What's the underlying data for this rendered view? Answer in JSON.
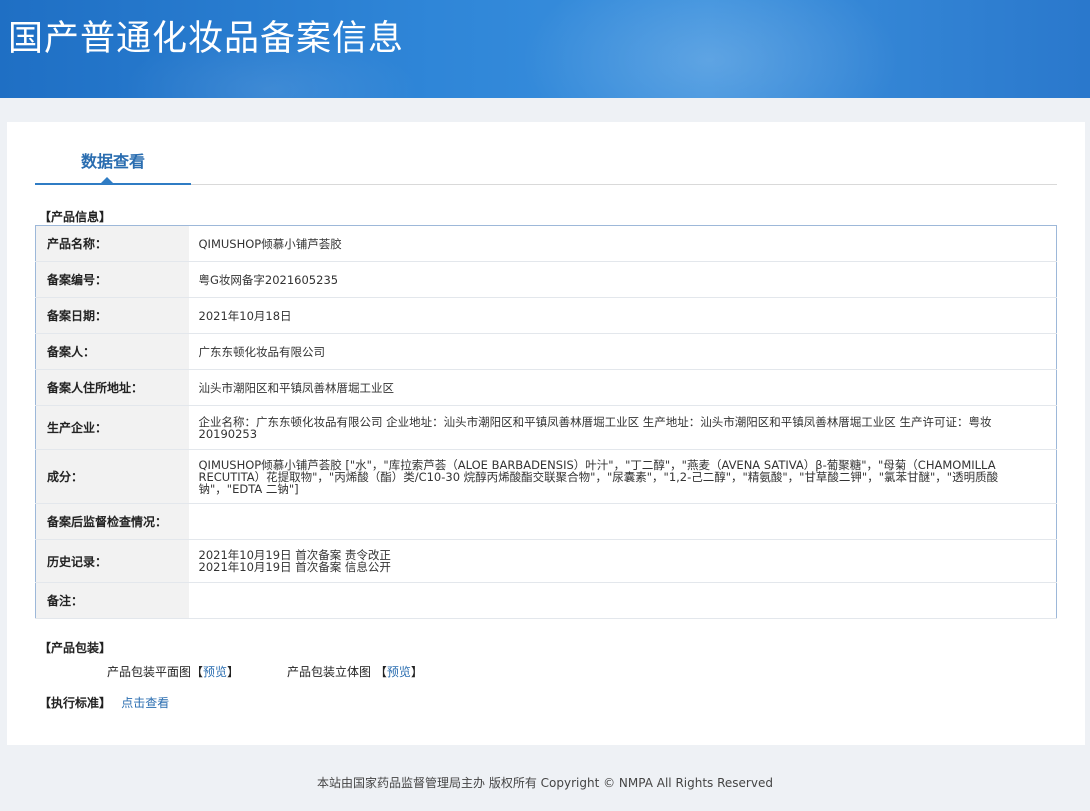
{
  "header": {
    "title": "国产普通化妆品备案信息"
  },
  "tabs": [
    {
      "label": "数据查看"
    }
  ],
  "sections": {
    "product_info": "【产品信息】",
    "product_packaging": "【产品包装】",
    "standard": "【执行标准】"
  },
  "product_table": [
    {
      "key": "产品名称：",
      "value": "QIMUSHOP倾慕小铺芦荟胶"
    },
    {
      "key": "备案编号：",
      "value": "粤G妆网备字2021605235"
    },
    {
      "key": "备案日期：",
      "value": "2021年10月18日"
    },
    {
      "key": "备案人：",
      "value": "广东东顿化妆品有限公司"
    },
    {
      "key": "备案人住所地址：",
      "value": "汕头市潮阳区和平镇凤善林厝堀工业区"
    },
    {
      "key": "生产企业：",
      "value": "企业名称：广东东顿化妆品有限公司 企业地址：汕头市潮阳区和平镇凤善林厝堀工业区 生产地址：汕头市潮阳区和平镇凤善林厝堀工业区 生产许可证：粤妆20190253"
    },
    {
      "key": "成分：",
      "value": "QIMUSHOP倾慕小铺芦荟胶 [\"水\"，\"库拉索芦荟（ALOE BARBADENSIS）叶汁\"，\"丁二醇\"，\"燕麦（AVENA SATIVA）β-葡聚糖\"，\"母菊（CHAMOMILLA RECUTITA）花提取物\"，\"丙烯酸（酯）类/C10-30 烷醇丙烯酸酯交联聚合物\"，\"尿囊素\"，\"1,2-己二醇\"，\"精氨酸\"，\"甘草酸二钾\"，\"氯苯甘醚\"，\"透明质酸钠\"，\"EDTA 二钠\"]"
    },
    {
      "key": "备案后监督检查情况：",
      "value": ""
    },
    {
      "key": "历史记录：",
      "value": "2021年10月19日 首次备案 责令改正\n2021年10月19日 首次备案 信息公开"
    },
    {
      "key": "备注：",
      "value": ""
    }
  ],
  "packaging": {
    "flat_label": "产品包装平面图",
    "flat_preview": "预览",
    "solid_label": "产品包装立体图",
    "solid_preview": "预览"
  },
  "standard": {
    "link": "点击查看"
  },
  "footer": {
    "text": "本站由国家药品监督管理局主办 版权所有 Copyright © NMPA All Rights Reserved"
  }
}
